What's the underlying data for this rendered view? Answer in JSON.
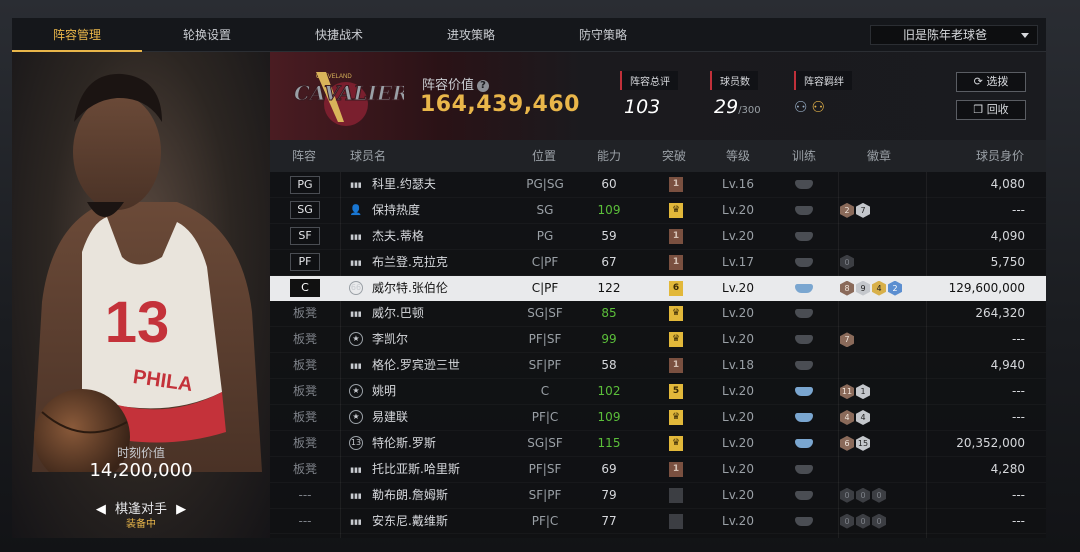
{
  "tabs": [
    {
      "label": "阵容管理",
      "active": true
    },
    {
      "label": "轮换设置",
      "active": false
    },
    {
      "label": "快捷战术",
      "active": false
    },
    {
      "label": "进攻策略",
      "active": false
    },
    {
      "label": "防守策略",
      "active": false
    }
  ],
  "dropdown": {
    "value": "旧是陈年老球爸"
  },
  "player_panel": {
    "jersey_number": "13",
    "jersey_text": "PHILA",
    "value_label": "时刻价值",
    "value": "14,200,000",
    "skill_label": "棋逢对手",
    "skill_status": "装备中",
    "prev_arrow": "◀",
    "next_arrow": "▶"
  },
  "team": {
    "logo_text_top": "CLEVELAND",
    "logo_text": "CAVALIERS",
    "lineup_value_label": "阵容价值",
    "lineup_value": "164,439,460",
    "rating_label": "阵容总评",
    "rating": "103",
    "player_count_label": "球员数",
    "player_count": "29",
    "player_count_max": "/300",
    "bond_label": "阵容羁绊",
    "select_button": "选拨",
    "recycle_button": "回收"
  },
  "table": {
    "headers": [
      "阵容",
      "球员名",
      "位置",
      "能力",
      "突破",
      "等级",
      "训练",
      "徽章",
      "球员身价"
    ],
    "rows": [
      {
        "slot": "PG",
        "bench": false,
        "icon": "bars",
        "name": "科里.约瑟夫",
        "pos": "PG|SG",
        "ability": "60",
        "ability_color": "#d6d8dc",
        "break": "1",
        "break_kind": "brown",
        "level": "Lv.16",
        "train": "grey",
        "badges": [],
        "salary": "4,080"
      },
      {
        "slot": "SG",
        "bench": false,
        "icon": "person",
        "name": "保持热度",
        "pos": "SG",
        "ability": "109",
        "ability_color": "#5bbf3a",
        "break": "♛",
        "break_kind": "gold",
        "level": "Lv.20",
        "train": "grey",
        "badges": [
          {
            "v": "2",
            "k": "bronze"
          },
          {
            "v": "7",
            "k": "silver"
          }
        ],
        "salary": "---"
      },
      {
        "slot": "SF",
        "bench": false,
        "icon": "bars",
        "name": "杰夫.蒂格",
        "pos": "PG",
        "ability": "59",
        "ability_color": "#d6d8dc",
        "break": "1",
        "break_kind": "brown",
        "level": "Lv.20",
        "train": "grey",
        "badges": [],
        "salary": "4,090"
      },
      {
        "slot": "PF",
        "bench": false,
        "icon": "bars",
        "name": "布兰登.克拉克",
        "pos": "C|PF",
        "ability": "67",
        "ability_color": "#d6d8dc",
        "break": "1",
        "break_kind": "brown",
        "level": "Lv.17",
        "train": "grey",
        "badges": [
          {
            "v": "0",
            "k": "dark"
          }
        ],
        "salary": "5,750"
      },
      {
        "slot": "C",
        "bench": false,
        "selected": true,
        "icon": "66",
        "name": "威尔特.张伯伦",
        "pos": "C|PF",
        "ability": "122",
        "ability_color": "#111111",
        "break": "6",
        "break_kind": "gold",
        "level": "Lv.20",
        "train": "blue",
        "badges": [
          {
            "v": "8",
            "k": "bronze"
          },
          {
            "v": "9",
            "k": "silver"
          },
          {
            "v": "4",
            "k": "gold"
          },
          {
            "v": "2",
            "k": "blue"
          }
        ],
        "salary": "129,600,000"
      },
      {
        "slot": "板凳",
        "bench": true,
        "icon": "bars",
        "name": "威尔.巴顿",
        "pos": "SG|SF",
        "ability": "85",
        "ability_color": "#5bbf3a",
        "break": "♛",
        "break_kind": "gold",
        "level": "Lv.20",
        "train": "grey",
        "badges": [],
        "salary": "264,320"
      },
      {
        "slot": "板凳",
        "bench": true,
        "icon": "star",
        "name": "李凯尔",
        "pos": "PF|SF",
        "ability": "99",
        "ability_color": "#5bbf3a",
        "break": "♛",
        "break_kind": "gold",
        "level": "Lv.20",
        "train": "grey",
        "badges": [
          {
            "v": "7",
            "k": "bronze"
          }
        ],
        "salary": "---"
      },
      {
        "slot": "板凳",
        "bench": true,
        "icon": "bars",
        "name": "格伦.罗宾逊三世",
        "pos": "SF|PF",
        "ability": "58",
        "ability_color": "#d6d8dc",
        "break": "1",
        "break_kind": "brown",
        "level": "Lv.18",
        "train": "grey",
        "badges": [],
        "salary": "4,940"
      },
      {
        "slot": "板凳",
        "bench": true,
        "icon": "star",
        "name": "姚明",
        "pos": "C",
        "ability": "102",
        "ability_color": "#5bbf3a",
        "break": "5",
        "break_kind": "gold",
        "level": "Lv.20",
        "train": "blue",
        "badges": [
          {
            "v": "11",
            "k": "bronze"
          },
          {
            "v": "1",
            "k": "silver"
          }
        ],
        "salary": "---"
      },
      {
        "slot": "板凳",
        "bench": true,
        "icon": "star",
        "name": "易建联",
        "pos": "PF|C",
        "ability": "109",
        "ability_color": "#5bbf3a",
        "break": "♛",
        "break_kind": "gold",
        "level": "Lv.20",
        "train": "blue",
        "badges": [
          {
            "v": "4",
            "k": "bronze"
          },
          {
            "v": "4",
            "k": "silver"
          }
        ],
        "salary": "---"
      },
      {
        "slot": "板凳",
        "bench": true,
        "icon": "13",
        "name": "特伦斯.罗斯",
        "pos": "SG|SF",
        "ability": "115",
        "ability_color": "#5bbf3a",
        "break": "♛",
        "break_kind": "gold",
        "level": "Lv.20",
        "train": "blue",
        "badges": [
          {
            "v": "6",
            "k": "bronze"
          },
          {
            "v": "15",
            "k": "silver"
          }
        ],
        "salary": "20,352,000"
      },
      {
        "slot": "板凳",
        "bench": true,
        "icon": "bars",
        "name": "托比亚斯.哈里斯",
        "pos": "PF|SF",
        "ability": "69",
        "ability_color": "#d6d8dc",
        "break": "1",
        "break_kind": "brown",
        "level": "Lv.20",
        "train": "grey",
        "badges": [],
        "salary": "4,280"
      },
      {
        "slot": "---",
        "bench": true,
        "icon": "bars",
        "name": "勒布朗.詹姆斯",
        "pos": "SF|PF",
        "ability": "79",
        "ability_color": "#d6d8dc",
        "break": "",
        "break_kind": "grey",
        "level": "Lv.20",
        "train": "grey",
        "badges": [
          {
            "v": "0",
            "k": "dark"
          },
          {
            "v": "0",
            "k": "dark"
          },
          {
            "v": "0",
            "k": "dark"
          }
        ],
        "salary": "---"
      },
      {
        "slot": "---",
        "bench": true,
        "icon": "bars",
        "name": "安东尼.戴维斯",
        "pos": "PF|C",
        "ability": "77",
        "ability_color": "#d6d8dc",
        "break": "",
        "break_kind": "grey",
        "level": "Lv.20",
        "train": "grey",
        "badges": [
          {
            "v": "0",
            "k": "dark"
          },
          {
            "v": "0",
            "k": "dark"
          },
          {
            "v": "0",
            "k": "dark"
          }
        ],
        "salary": "---"
      }
    ]
  }
}
